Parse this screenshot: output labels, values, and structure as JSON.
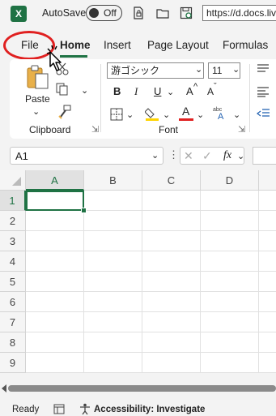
{
  "titlebar": {
    "autosave_label": "AutoSave",
    "autosave_state": "Off",
    "url": "https://d.docs.live"
  },
  "tabs": [
    {
      "label": "File"
    },
    {
      "label": "Home"
    },
    {
      "label": "Insert"
    },
    {
      "label": "Page Layout"
    },
    {
      "label": "Formulas"
    }
  ],
  "active_tab": "Home",
  "ribbon": {
    "clipboard": {
      "paste_label": "Paste",
      "group_label": "Clipboard"
    },
    "font": {
      "font_name": "游ゴシック",
      "font_size": "11",
      "bold": "B",
      "italic": "I",
      "underline": "U",
      "grow": "A",
      "shrink": "A",
      "font_color_letter": "A",
      "group_label": "Font",
      "font_color": "#e02020",
      "highlight_color": "#ffd400"
    }
  },
  "formula_bar": {
    "namebox": "A1",
    "fx": "fx",
    "cancel": "✕",
    "enter": "✓"
  },
  "grid": {
    "columns": [
      "A",
      "B",
      "C",
      "D"
    ],
    "rows": [
      "1",
      "2",
      "3",
      "4",
      "5",
      "6",
      "7",
      "8",
      "9"
    ],
    "selected_cell": "A1"
  },
  "status": {
    "ready": "Ready",
    "accessibility": "Accessibility: Investigate"
  },
  "colors": {
    "accent": "#1f7244",
    "highlight_circle": "#e02020"
  }
}
